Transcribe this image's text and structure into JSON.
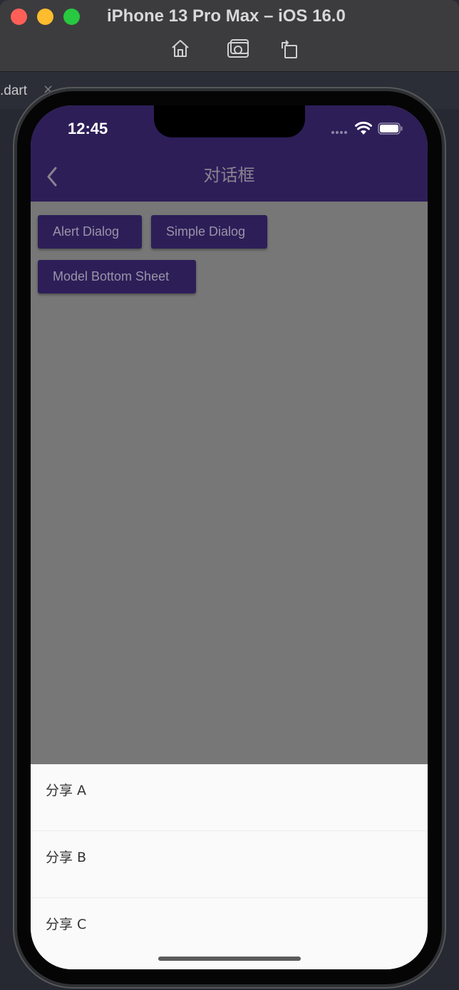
{
  "window": {
    "title": "iPhone 13 Pro Max – iOS 16.0",
    "toolbar": {
      "icons": [
        "home-icon",
        "screenshot-icon",
        "rotate-icon"
      ]
    }
  },
  "ide": {
    "tab_label": ".dart",
    "tab_close": "×"
  },
  "status_bar": {
    "time": "12:45"
  },
  "app_bar": {
    "title": "对话框",
    "back_icon": "back-icon"
  },
  "buttons": {
    "alert": "Alert Dialog",
    "simple": "Simple Dialog",
    "bottom_sheet": "Model Bottom Sheet"
  },
  "bottom_sheet": {
    "items": [
      {
        "label": "分享 A"
      },
      {
        "label": "分享 B"
      },
      {
        "label": "分享 C"
      }
    ]
  },
  "colors": {
    "app_bar": "#2d1e58",
    "scrim": "#777777",
    "sheet_bg": "#fafafa",
    "button_text": "#9a94a8"
  }
}
